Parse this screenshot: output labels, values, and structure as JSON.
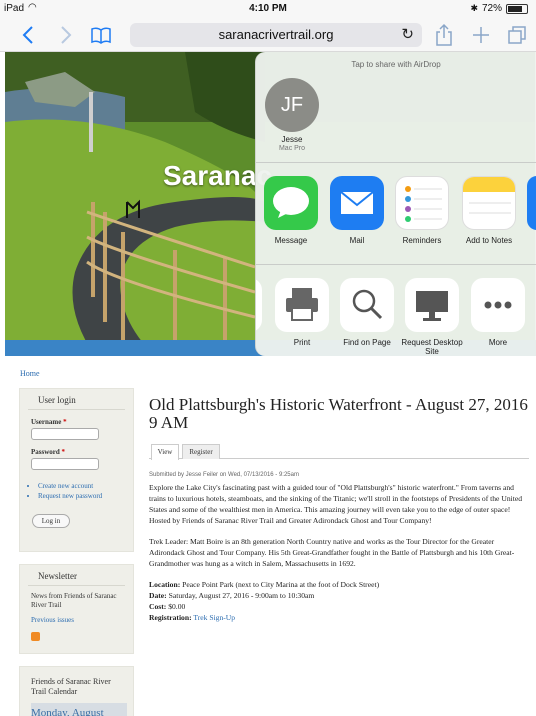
{
  "status_bar": {
    "device": "iPad",
    "time": "4:10 PM",
    "battery": "72%"
  },
  "toolbar": {
    "url": "saranacrivertrail.org"
  },
  "hero": {
    "site_title": "Saranac"
  },
  "share_sheet": {
    "airdrop_caption": "Tap to share with AirDrop",
    "person": {
      "initials": "JF",
      "name": "Jesse",
      "device": "Mac Pro"
    },
    "apps": [
      {
        "label": "Message"
      },
      {
        "label": "Mail"
      },
      {
        "label": "Reminders"
      },
      {
        "label": "Add to Notes"
      }
    ],
    "actions": [
      {
        "label": "Print"
      },
      {
        "label": "Find on Page"
      },
      {
        "label": "Request Desktop Site"
      },
      {
        "label": "More"
      }
    ]
  },
  "breadcrumb": "Home",
  "user_login": {
    "title": "User login",
    "username_label": "Username",
    "password_label": "Password",
    "required_mark": "*",
    "links": [
      "Create new account",
      "Request new password"
    ],
    "login_button": "Log in"
  },
  "newsletter": {
    "title": "Newsletter",
    "text": "News from Friends of Saranac River Trail",
    "link": "Previous issues"
  },
  "calendar": {
    "title": "Friends of Saranac River Trail Calendar",
    "strip": "Monday, August"
  },
  "article": {
    "title": "Old Plattsburgh's Historic Waterfront - August 27, 2016 9 AM",
    "tabs": [
      "View",
      "Register"
    ],
    "submitted": "Submitted by Jesse Feiler on Wed, 07/13/2016 - 9:25am",
    "para1": "Explore the Lake City's fascinating past with a guided tour of \"Old Plattsburgh's\" historic waterfront.\" From taverns and trains to luxurious hotels, steamboats, and the sinking of the Titanic; we'll stroll in the footsteps of Presidents of the United States and some of the wealthiest men in America. This amazing journey will even take you to the edge of outer space! Hosted by Friends of Saranac River Trail and Greater Adirondack Ghost and Tour Company!",
    "para2": "Trek Leader: Matt Boire is an 8th generation North Country native and works as the Tour Director for the Greater Adirondack Ghost and Tour Company. His 5th Great-Grandfather fought in the Battle of Plattsburgh and his 10th Great-Grandmother was hung as a witch in Salem, Massachusetts in 1692.",
    "location_label": "Location:",
    "location": "Peace Point Park (next to City Marina at the foot of Dock Street)",
    "date_label": "Date:",
    "date": "Saturday, August 27, 2016 - 9:00am to 10:30am",
    "cost_label": "Cost:",
    "cost": "$0.00",
    "registration_label": "Registration:",
    "registration_link": "Trek Sign-Up"
  }
}
